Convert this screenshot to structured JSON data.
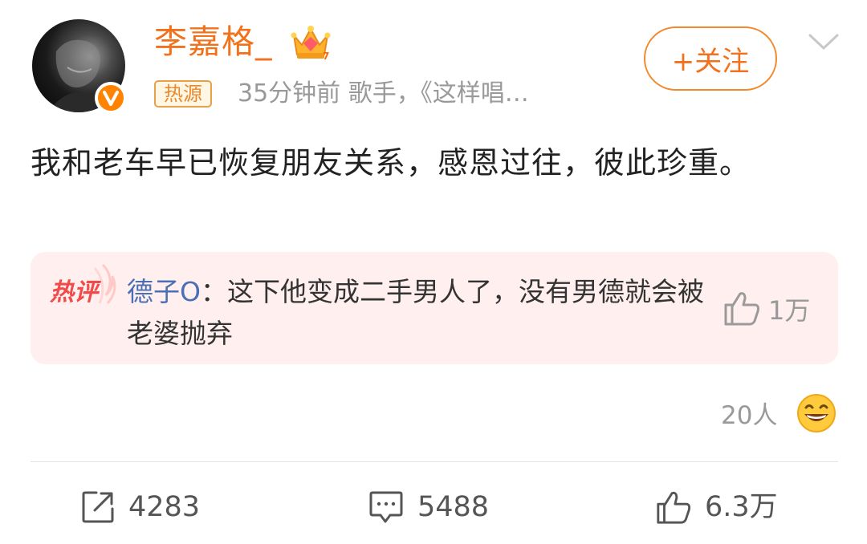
{
  "post": {
    "author": "李嘉格_",
    "badge": "热源",
    "meta": "35分钟前   歌手，《这样唱…",
    "follow_label": "+关注",
    "text": "我和老车早已恢复朋友关系，感恩过往，彼此珍重。"
  },
  "hot_comment": {
    "label": "热评",
    "user": "德子O",
    "text": "：这下他变成二手男人了，没有男德就会被老婆抛弃",
    "likes": "1万"
  },
  "reactions": {
    "count": "20人",
    "emoji_icon": "grin-emoji-icon"
  },
  "actions": {
    "repost": "4283",
    "comment": "5488",
    "like": "6.3万"
  },
  "colors": {
    "accent": "#f2711c",
    "link": "#4a6fb5",
    "muted": "#999999",
    "hot_bg": "#fff0ef"
  }
}
